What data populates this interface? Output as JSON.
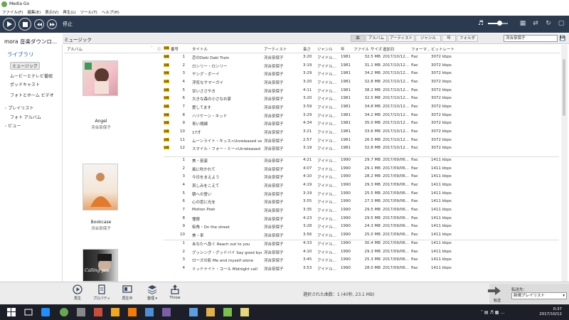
{
  "window": {
    "title": "Media Go",
    "menus": [
      "ファイル(F)",
      "編集(E)",
      "表示(V)",
      "再生(L)",
      "ツール(T)",
      "ヘルプ(H)"
    ]
  },
  "transport": {
    "status": "停止",
    "volume": 0.6
  },
  "library": {
    "source": "mora 音楽ダウンロ...",
    "section_title": "ミュージック",
    "view_tabs": [
      "曲",
      "アルバム",
      "アーティスト",
      "ジャンル",
      "年",
      "フォルダ"
    ],
    "search_value": "河合奈保子"
  },
  "sidebar": {
    "library_heading": "ライブラリ",
    "items": [
      {
        "label": "ミュージック",
        "selected": true
      },
      {
        "label": "ムービーとテレビ番組"
      },
      {
        "label": "ポッドキャスト"
      },
      {
        "label": "フォトとホーム ビデオ"
      },
      {
        "label": "プレイリスト",
        "expandable": true
      },
      {
        "label": "フォト アルバム"
      },
      {
        "label": "ビュー",
        "expandable": true
      }
    ]
  },
  "columns": {
    "album": "アルバム",
    "track_no": "番号",
    "title": "タイトル",
    "artist": "アーティスト",
    "length": "長さ",
    "genre": "ジャンル",
    "year": "年",
    "size": "ファイル サイズ",
    "date_added": "追加日",
    "format": "フォーマ...",
    "bitrate": "ビットレート",
    "hr_badge": "HR"
  },
  "albums": [
    {
      "name": "Angel",
      "artist": "河合奈保子",
      "tracks": [
        {
          "hr": true,
          "no": "1",
          "title": "恋のDeki Daki Train",
          "artist": "河合奈保子",
          "len": "3:20",
          "genre": "アイドル...",
          "year": "1981",
          "size": "32.5 MB",
          "date": "2017/10/12...",
          "fmt": "flac",
          "br": "3072 kbps"
        },
        {
          "hr": true,
          "no": "2",
          "title": "ロンリー・ロンリー",
          "artist": "河合奈保子",
          "len": "3:19",
          "genre": "アイドル...",
          "year": "1981",
          "size": "31.1 MB",
          "date": "2017/10/12...",
          "fmt": "flac",
          "br": "3072 kbps"
        },
        {
          "hr": true,
          "no": "3",
          "title": "ヤング・ボーイ",
          "artist": "河合奈保子",
          "len": "3:29",
          "genre": "アイドル...",
          "year": "1981",
          "size": "34.2 MB",
          "date": "2017/10/12...",
          "fmt": "flac",
          "br": "3072 kbps"
        },
        {
          "hr": true,
          "no": "4",
          "title": "浮気なサマーガイ",
          "artist": "河合奈保子",
          "len": "3:20",
          "genre": "アイドル...",
          "year": "1981",
          "size": "32.8 MB",
          "date": "2017/10/12...",
          "fmt": "flac",
          "br": "3072 kbps"
        },
        {
          "hr": true,
          "no": "5",
          "title": "甘いささやき",
          "artist": "河合奈保子",
          "len": "4:11",
          "genre": "アイドル...",
          "year": "1981",
          "size": "38.2 MB",
          "date": "2017/10/12...",
          "fmt": "flac",
          "br": "3072 kbps"
        },
        {
          "hr": true,
          "no": "6",
          "title": "大きな森の小さなお家",
          "artist": "河合奈保子",
          "len": "3:20",
          "genre": "アイドル...",
          "year": "1981",
          "size": "32.5 MB",
          "date": "2017/10/12...",
          "fmt": "flac",
          "br": "3072 kbps"
        },
        {
          "hr": true,
          "no": "7",
          "title": "愛してます",
          "artist": "河合奈保子",
          "len": "3:59",
          "genre": "アイドル...",
          "year": "1981",
          "size": "34.8 MB",
          "date": "2017/10/12...",
          "fmt": "flac",
          "br": "3072 kbps"
        },
        {
          "hr": true,
          "no": "8",
          "title": "ハリケーン・キッド",
          "artist": "河合奈保子",
          "len": "3:29",
          "genre": "アイドル...",
          "year": "1981",
          "size": "34.2 MB",
          "date": "2017/10/12...",
          "fmt": "flac",
          "br": "3072 kbps"
        },
        {
          "hr": true,
          "no": "9",
          "title": "青い視線",
          "artist": "河合奈保子",
          "len": "4:34",
          "genre": "アイドル...",
          "year": "1981",
          "size": "35.0 MB",
          "date": "2017/10/12...",
          "fmt": "flac",
          "br": "3072 kbps"
        },
        {
          "hr": true,
          "no": "10",
          "title": "17才",
          "artist": "河合奈保子",
          "len": "3:21",
          "genre": "アイドル...",
          "year": "1981",
          "size": "33.6 MB",
          "date": "2017/10/12...",
          "fmt": "flac",
          "br": "3072 kbps"
        },
        {
          "hr": true,
          "no": "11",
          "title": "ムーンライト・キッス<Unreleased versi...",
          "artist": "河合奈保子",
          "len": "2:57",
          "genre": "アイドル...",
          "year": "1981",
          "size": "26.5 MB",
          "date": "2017/10/12...",
          "fmt": "flac",
          "br": "3072 kbps"
        },
        {
          "hr": true,
          "no": "12",
          "title": "スマイル・フォー・ミー<Unreleased versi...",
          "artist": "河合奈保子",
          "len": "3:19",
          "genre": "アイドル...",
          "year": "1981",
          "size": "32.8 MB",
          "date": "2017/10/12...",
          "fmt": "flac",
          "br": "3072 kbps"
        }
      ]
    },
    {
      "name": "Bookcase",
      "artist": "河合奈保子",
      "tracks": [
        {
          "hr": false,
          "no": "1",
          "title": "美・容姿",
          "artist": "河合奈保子",
          "len": "4:21",
          "genre": "アイドル...",
          "year": "1990",
          "size": "29.7 MB",
          "date": "2017/09/06...",
          "fmt": "flac",
          "br": "1411 kbps"
        },
        {
          "hr": false,
          "no": "2",
          "title": "風に吹かれて",
          "artist": "河合奈保子",
          "len": "4:07",
          "genre": "アイドル...",
          "year": "1990",
          "size": "29.1 MB",
          "date": "2017/09/06...",
          "fmt": "flac",
          "br": "1411 kbps"
        },
        {
          "hr": false,
          "no": "3",
          "title": "今日をまえよう",
          "artist": "河合奈保子",
          "len": "4:10",
          "genre": "アイドル...",
          "year": "1990",
          "size": "28.2 MB",
          "date": "2017/09/06...",
          "fmt": "flac",
          "br": "1411 kbps"
        },
        {
          "hr": false,
          "no": "4",
          "title": "哀しみをこえて",
          "artist": "河合奈保子",
          "len": "4:19",
          "genre": "アイドル...",
          "year": "1990",
          "size": "29.3 MB",
          "date": "2017/09/06...",
          "fmt": "flac",
          "br": "1411 kbps"
        },
        {
          "hr": false,
          "no": "5",
          "title": "朝への誓い",
          "artist": "河合奈保子",
          "len": "3:19",
          "genre": "アイドル...",
          "year": "1990",
          "size": "25.5 MB",
          "date": "2017/09/06...",
          "fmt": "flac",
          "br": "1411 kbps"
        },
        {
          "hr": false,
          "no": "6",
          "title": "心の窓に光を",
          "artist": "河合奈保子",
          "len": "3:55",
          "genre": "アイドル...",
          "year": "1990",
          "size": "27.3 MB",
          "date": "2017/09/06...",
          "fmt": "flac",
          "br": "1411 kbps"
        },
        {
          "hr": false,
          "no": "7",
          "title": "Motion Poet",
          "artist": "河合奈保子",
          "len": "3:35",
          "genre": "アイドル...",
          "year": "1990",
          "size": "29.5 MB",
          "date": "2017/09/06...",
          "fmt": "flac",
          "br": "1411 kbps"
        },
        {
          "hr": false,
          "no": "8",
          "title": "憧憬",
          "artist": "河合奈保子",
          "len": "4:23",
          "genre": "アイドル...",
          "year": "1990",
          "size": "29.5 MB",
          "date": "2017/09/06...",
          "fmt": "flac",
          "br": "1411 kbps"
        },
        {
          "hr": false,
          "no": "9",
          "title": "街角・On the street",
          "artist": "河合奈保子",
          "len": "3:28",
          "genre": "アイドル...",
          "year": "1990",
          "size": "24.3 MB",
          "date": "2017/09/06...",
          "fmt": "flac",
          "br": "1411 kbps"
        },
        {
          "hr": false,
          "no": "10",
          "title": "美・来",
          "artist": "河合奈保子",
          "len": "3:56",
          "genre": "アイドル...",
          "year": "1990",
          "size": "25.0 MB",
          "date": "2017/09/06...",
          "fmt": "flac",
          "br": "1411 kbps"
        }
      ]
    },
    {
      "name": "Calling you",
      "artist": "河合奈保子",
      "tracks": [
        {
          "hr": false,
          "no": "1",
          "title": "あなたへ急ぐ Reach out to you",
          "artist": "河合奈保子",
          "len": "4:33",
          "genre": "アイドル...",
          "year": "1990",
          "size": "30.4 MB",
          "date": "2017/09/06...",
          "fmt": "flac",
          "br": "1411 kbps"
        },
        {
          "hr": false,
          "no": "2",
          "title": "グッシング・グッドバイ Say good bye",
          "artist": "河合奈保子",
          "len": "4:10",
          "genre": "アイドル...",
          "year": "1990",
          "size": "29.3 MB",
          "date": "2017/09/06...",
          "fmt": "flac",
          "br": "1411 kbps"
        },
        {
          "hr": false,
          "no": "3",
          "title": "ローズの影 Me and myself alone",
          "artist": "河合奈保子",
          "len": "3:45",
          "genre": "アイドル...",
          "year": "1990",
          "size": "25.3 MB",
          "date": "2017/09/06...",
          "fmt": "flac",
          "br": "1411 kbps"
        },
        {
          "hr": false,
          "no": "4",
          "title": "ミッドナイト・コール Midnight call",
          "artist": "河合奈保子",
          "len": "3:53",
          "genre": "アイドル...",
          "year": "1990",
          "size": "28.0 MB",
          "date": "2017/09/06...",
          "fmt": "flac",
          "br": "1411 kbps"
        }
      ]
    }
  ],
  "bottom": {
    "buttons": [
      "再生",
      "プロパティ",
      "再生中",
      "整理",
      "Throw"
    ],
    "selection_status": "選択された曲数：1 (40秒, 23.1 MB)",
    "transfer_label": "転送先：",
    "transfer_target": "新規プレイリスト",
    "transfer_caption": "転送"
  },
  "taskbar": {
    "time": "0:37",
    "date": "2017/10/12"
  }
}
